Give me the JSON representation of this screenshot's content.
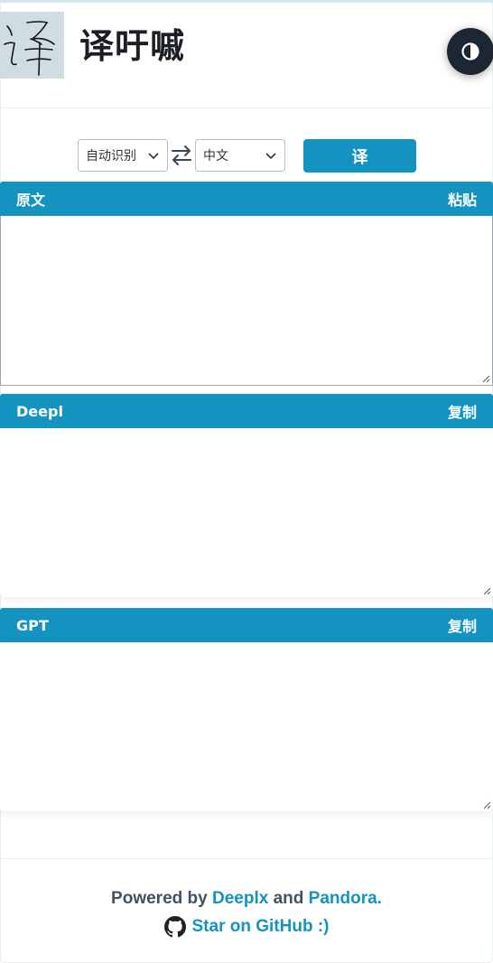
{
  "header": {
    "logo_glyph": "译",
    "title": "译吁嘁",
    "theme_icon": "half-circle-contrast-icon"
  },
  "controls": {
    "source_language": "自动识别",
    "target_language": "中文",
    "swap_icon": "swap-arrows-icon",
    "translate_label": "译"
  },
  "panels": {
    "source": {
      "title": "原文",
      "action": "粘贴",
      "value": ""
    },
    "deepl": {
      "title": "Deepl",
      "action": "复制",
      "value": ""
    },
    "gpt": {
      "title": "GPT",
      "action": "复制",
      "value": ""
    }
  },
  "footer": {
    "powered_by": "Powered by",
    "deeplx": "Deeplx",
    "and": "and",
    "pandora": "Pandora.",
    "github_icon": "github-icon",
    "github_label": "Star on GitHub :)"
  },
  "colors": {
    "accent": "#1593c0",
    "title": "#1b1f24",
    "toggle_bg": "#1d2731",
    "footer_text": "#415162"
  }
}
